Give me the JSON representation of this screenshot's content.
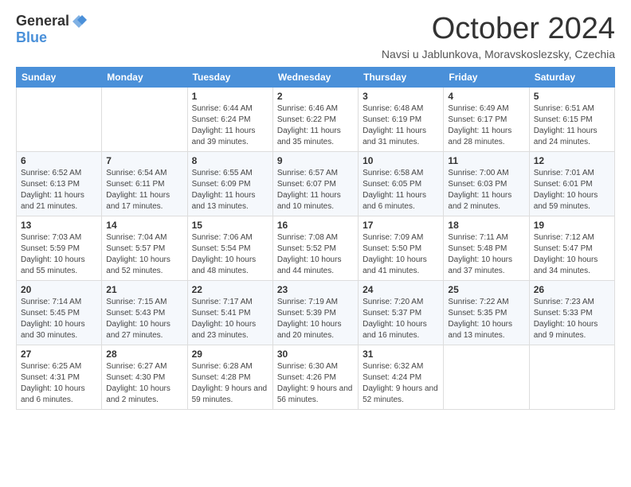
{
  "header": {
    "logo_general": "General",
    "logo_blue": "Blue",
    "month_title": "October 2024",
    "location": "Navsi u Jablunkova, Moravskoslezsky, Czechia"
  },
  "days_of_week": [
    "Sunday",
    "Monday",
    "Tuesday",
    "Wednesday",
    "Thursday",
    "Friday",
    "Saturday"
  ],
  "weeks": [
    [
      {
        "num": "",
        "info": ""
      },
      {
        "num": "",
        "info": ""
      },
      {
        "num": "1",
        "info": "Sunrise: 6:44 AM\nSunset: 6:24 PM\nDaylight: 11 hours and 39 minutes."
      },
      {
        "num": "2",
        "info": "Sunrise: 6:46 AM\nSunset: 6:22 PM\nDaylight: 11 hours and 35 minutes."
      },
      {
        "num": "3",
        "info": "Sunrise: 6:48 AM\nSunset: 6:19 PM\nDaylight: 11 hours and 31 minutes."
      },
      {
        "num": "4",
        "info": "Sunrise: 6:49 AM\nSunset: 6:17 PM\nDaylight: 11 hours and 28 minutes."
      },
      {
        "num": "5",
        "info": "Sunrise: 6:51 AM\nSunset: 6:15 PM\nDaylight: 11 hours and 24 minutes."
      }
    ],
    [
      {
        "num": "6",
        "info": "Sunrise: 6:52 AM\nSunset: 6:13 PM\nDaylight: 11 hours and 21 minutes."
      },
      {
        "num": "7",
        "info": "Sunrise: 6:54 AM\nSunset: 6:11 PM\nDaylight: 11 hours and 17 minutes."
      },
      {
        "num": "8",
        "info": "Sunrise: 6:55 AM\nSunset: 6:09 PM\nDaylight: 11 hours and 13 minutes."
      },
      {
        "num": "9",
        "info": "Sunrise: 6:57 AM\nSunset: 6:07 PM\nDaylight: 11 hours and 10 minutes."
      },
      {
        "num": "10",
        "info": "Sunrise: 6:58 AM\nSunset: 6:05 PM\nDaylight: 11 hours and 6 minutes."
      },
      {
        "num": "11",
        "info": "Sunrise: 7:00 AM\nSunset: 6:03 PM\nDaylight: 11 hours and 2 minutes."
      },
      {
        "num": "12",
        "info": "Sunrise: 7:01 AM\nSunset: 6:01 PM\nDaylight: 10 hours and 59 minutes."
      }
    ],
    [
      {
        "num": "13",
        "info": "Sunrise: 7:03 AM\nSunset: 5:59 PM\nDaylight: 10 hours and 55 minutes."
      },
      {
        "num": "14",
        "info": "Sunrise: 7:04 AM\nSunset: 5:57 PM\nDaylight: 10 hours and 52 minutes."
      },
      {
        "num": "15",
        "info": "Sunrise: 7:06 AM\nSunset: 5:54 PM\nDaylight: 10 hours and 48 minutes."
      },
      {
        "num": "16",
        "info": "Sunrise: 7:08 AM\nSunset: 5:52 PM\nDaylight: 10 hours and 44 minutes."
      },
      {
        "num": "17",
        "info": "Sunrise: 7:09 AM\nSunset: 5:50 PM\nDaylight: 10 hours and 41 minutes."
      },
      {
        "num": "18",
        "info": "Sunrise: 7:11 AM\nSunset: 5:48 PM\nDaylight: 10 hours and 37 minutes."
      },
      {
        "num": "19",
        "info": "Sunrise: 7:12 AM\nSunset: 5:47 PM\nDaylight: 10 hours and 34 minutes."
      }
    ],
    [
      {
        "num": "20",
        "info": "Sunrise: 7:14 AM\nSunset: 5:45 PM\nDaylight: 10 hours and 30 minutes."
      },
      {
        "num": "21",
        "info": "Sunrise: 7:15 AM\nSunset: 5:43 PM\nDaylight: 10 hours and 27 minutes."
      },
      {
        "num": "22",
        "info": "Sunrise: 7:17 AM\nSunset: 5:41 PM\nDaylight: 10 hours and 23 minutes."
      },
      {
        "num": "23",
        "info": "Sunrise: 7:19 AM\nSunset: 5:39 PM\nDaylight: 10 hours and 20 minutes."
      },
      {
        "num": "24",
        "info": "Sunrise: 7:20 AM\nSunset: 5:37 PM\nDaylight: 10 hours and 16 minutes."
      },
      {
        "num": "25",
        "info": "Sunrise: 7:22 AM\nSunset: 5:35 PM\nDaylight: 10 hours and 13 minutes."
      },
      {
        "num": "26",
        "info": "Sunrise: 7:23 AM\nSunset: 5:33 PM\nDaylight: 10 hours and 9 minutes."
      }
    ],
    [
      {
        "num": "27",
        "info": "Sunrise: 6:25 AM\nSunset: 4:31 PM\nDaylight: 10 hours and 6 minutes."
      },
      {
        "num": "28",
        "info": "Sunrise: 6:27 AM\nSunset: 4:30 PM\nDaylight: 10 hours and 2 minutes."
      },
      {
        "num": "29",
        "info": "Sunrise: 6:28 AM\nSunset: 4:28 PM\nDaylight: 9 hours and 59 minutes."
      },
      {
        "num": "30",
        "info": "Sunrise: 6:30 AM\nSunset: 4:26 PM\nDaylight: 9 hours and 56 minutes."
      },
      {
        "num": "31",
        "info": "Sunrise: 6:32 AM\nSunset: 4:24 PM\nDaylight: 9 hours and 52 minutes."
      },
      {
        "num": "",
        "info": ""
      },
      {
        "num": "",
        "info": ""
      }
    ]
  ]
}
